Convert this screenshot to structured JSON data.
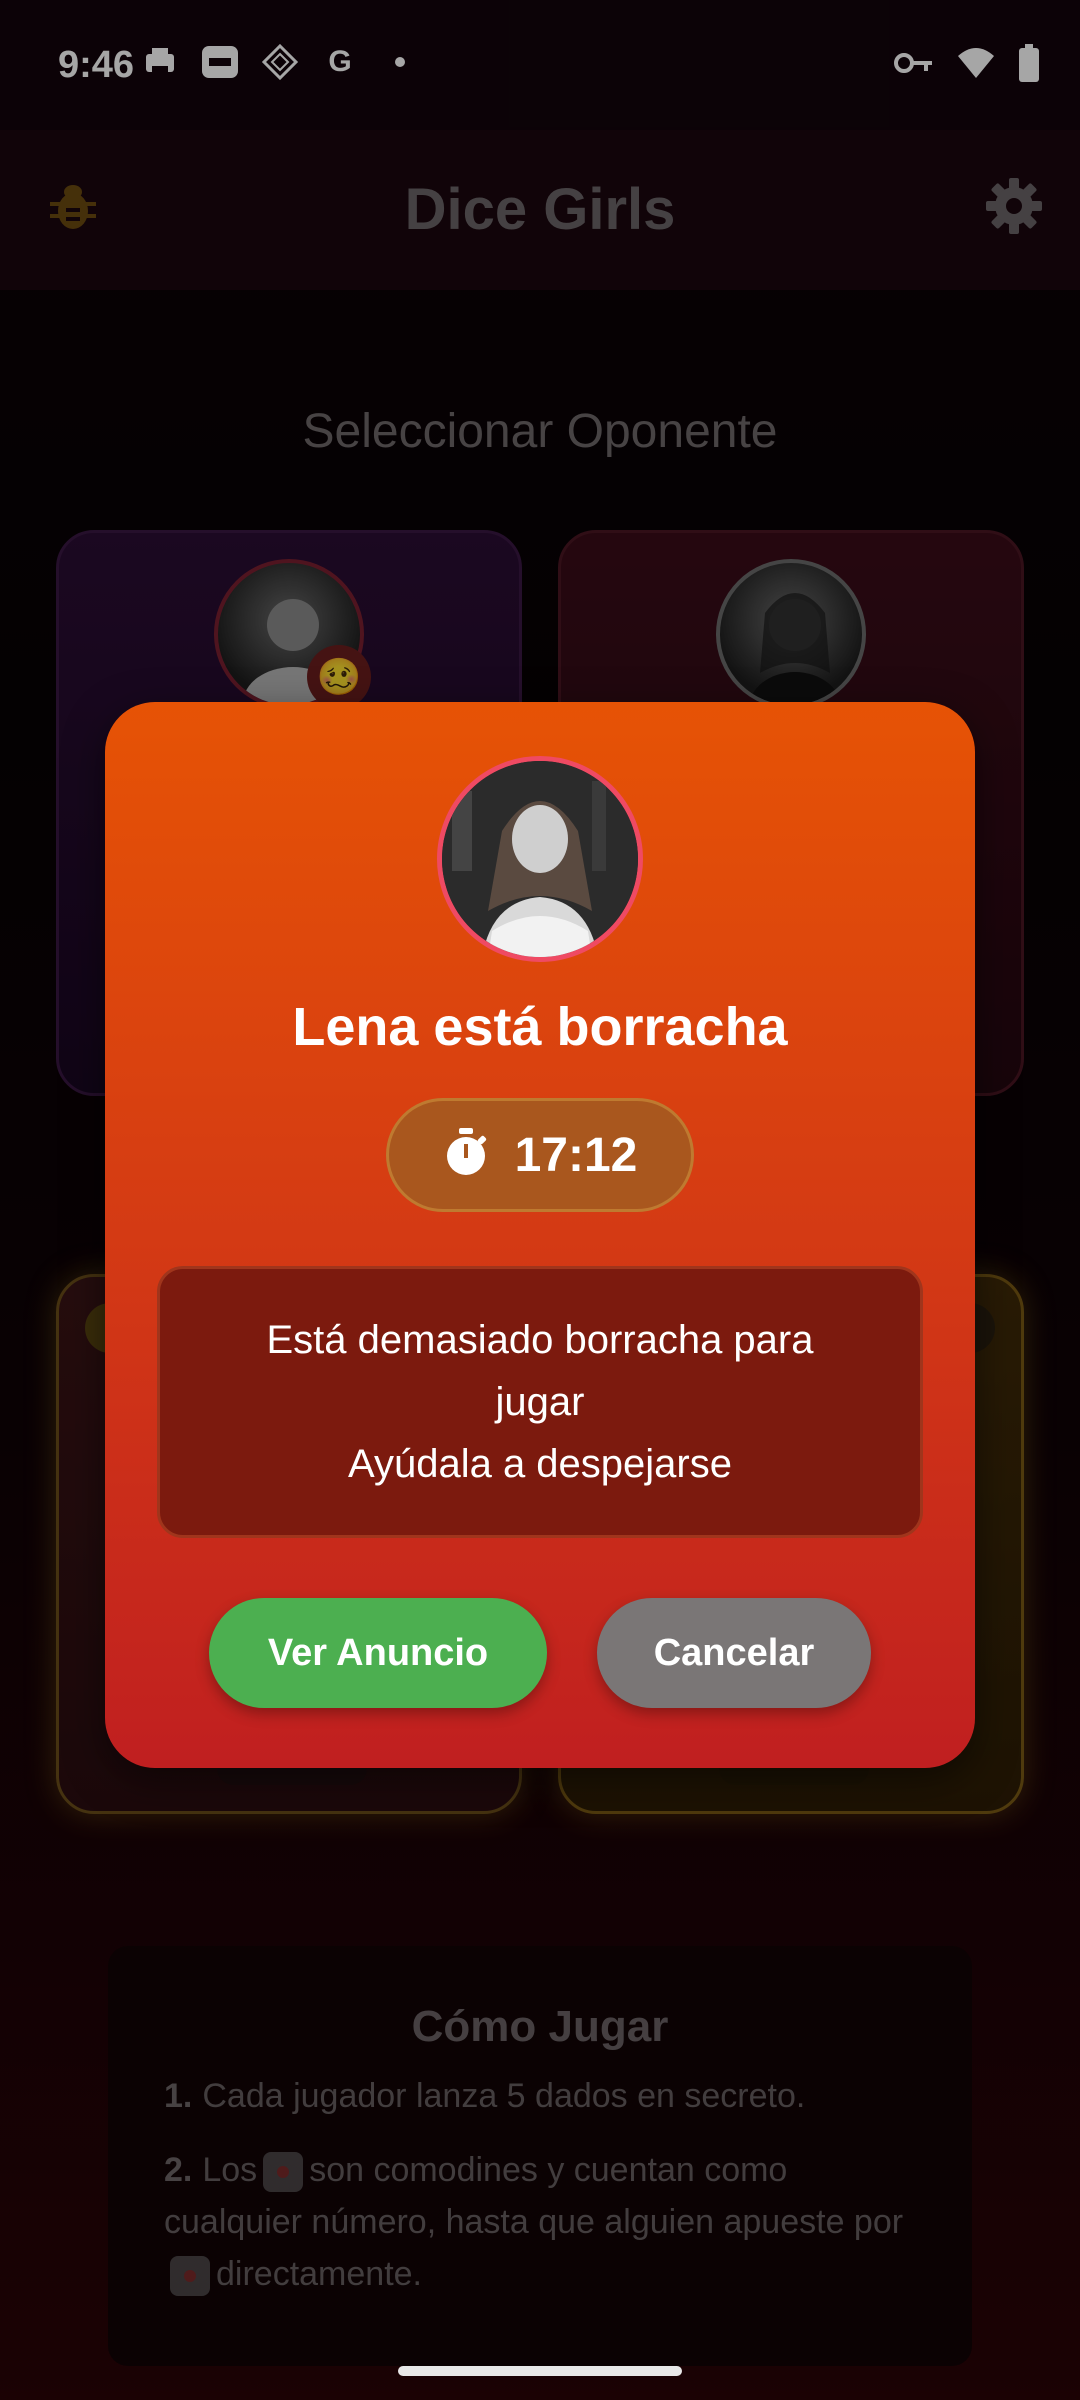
{
  "status_bar": {
    "time": "9:46",
    "icons_left": [
      "printer-icon",
      "badge-icon",
      "diamond-icon",
      "google-icon",
      "dot-icon"
    ],
    "icons_right": [
      "vpn-key-icon",
      "wifi-icon",
      "battery-icon"
    ]
  },
  "app_bar": {
    "title": "Dice Girls",
    "left_icon": "bug-icon",
    "right_icon": "gear-icon",
    "accent": "#6b4a10"
  },
  "main": {
    "section_title": "Seleccionar Oponente",
    "cards": [
      {
        "id": "card1",
        "status_icon": "drunk-emoji",
        "status_glyph": "🥴"
      },
      {
        "id": "card2"
      },
      {
        "id": "card3"
      },
      {
        "id": "card4"
      }
    ]
  },
  "how_to": {
    "title": "Cómo Jugar",
    "items": [
      {
        "num": "1.",
        "text": "Cada jugador lanza 5 dados en secreto."
      },
      {
        "num": "2.",
        "text_a": "Los",
        "text_b": "son comodines y cuentan como cualquier número, hasta que alguien apueste por",
        "text_c": "directamente."
      }
    ]
  },
  "modal": {
    "title": "Lena está borracha",
    "timer": "17:12",
    "message_line1": "Está demasiado borracha para",
    "message_line2": "jugar",
    "message_line3": "Ayúdala a despejarse",
    "primary_button": "Ver Anuncio",
    "secondary_button": "Cancelar",
    "colors": {
      "gradient_top": "#e65305",
      "gradient_bottom": "#c01f20",
      "primary": "#4caf50",
      "secondary": "#7a7676"
    }
  }
}
